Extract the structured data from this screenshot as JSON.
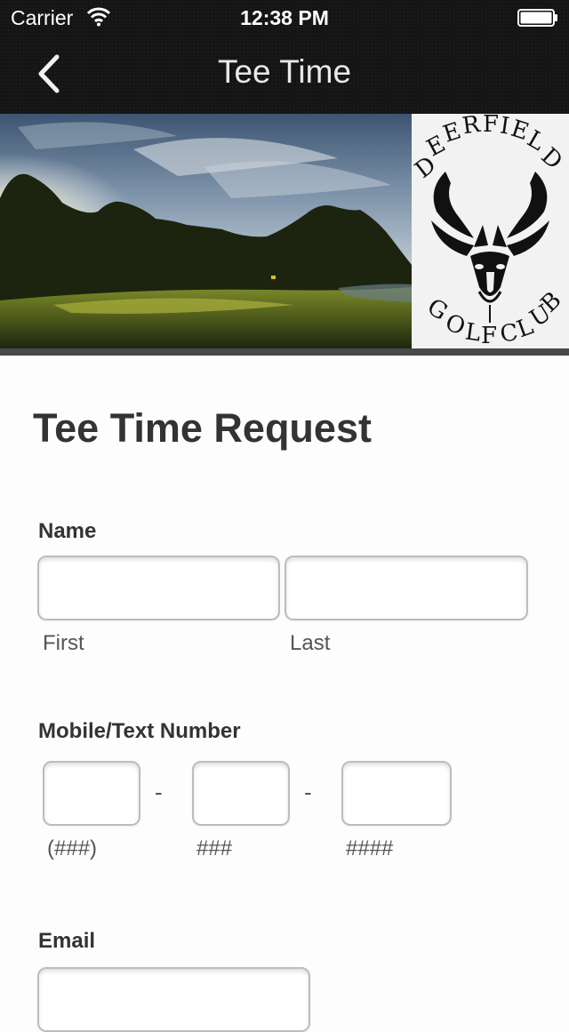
{
  "status_bar": {
    "carrier": "Carrier",
    "time": "12:38 PM"
  },
  "nav": {
    "title": "Tee Time"
  },
  "banner": {
    "logo_top_text": "DEERFIELD",
    "logo_bottom_text": "GOLF CLUB"
  },
  "form": {
    "title": "Tee Time Request",
    "name": {
      "label": "Name",
      "first_value": "",
      "last_value": "",
      "first_sub": "First",
      "last_sub": "Last"
    },
    "phone": {
      "label": "Mobile/Text Number",
      "area_value": "",
      "prefix_value": "",
      "line_value": "",
      "area_sub": "(###)",
      "prefix_sub": "###",
      "line_sub": "####",
      "separator": "-"
    },
    "email": {
      "label": "Email",
      "value": ""
    }
  }
}
